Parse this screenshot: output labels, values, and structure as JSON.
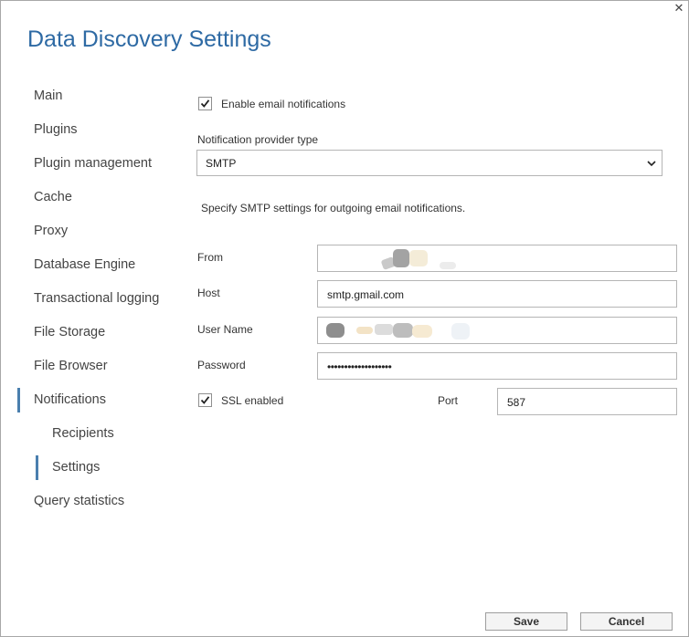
{
  "window": {
    "title": "Data Discovery Settings",
    "close_glyph": "✕"
  },
  "sidebar": {
    "items": [
      {
        "label": "Main"
      },
      {
        "label": "Plugins"
      },
      {
        "label": "Plugin management"
      },
      {
        "label": "Cache"
      },
      {
        "label": "Proxy"
      },
      {
        "label": "Database Engine"
      },
      {
        "label": "Transactional logging"
      },
      {
        "label": "File Storage"
      },
      {
        "label": "File Browser"
      },
      {
        "label": "Notifications"
      },
      {
        "label": "Recipients"
      },
      {
        "label": "Settings"
      },
      {
        "label": "Query statistics"
      }
    ]
  },
  "form": {
    "enable_notifications": {
      "label": "Enable email notifications",
      "checked": true
    },
    "provider_type": {
      "label": "Notification provider type",
      "value": "SMTP"
    },
    "smtp_hint": "Specify SMTP settings for outgoing email notifications.",
    "from": {
      "label": "From",
      "value": ""
    },
    "host": {
      "label": "Host",
      "value": "smtp.gmail.com"
    },
    "username": {
      "label": "User Name",
      "value": ""
    },
    "password": {
      "label": "Password",
      "value": "•••••••••••••••••••"
    },
    "ssl": {
      "label": "SSL enabled",
      "checked": true
    },
    "port": {
      "label": "Port",
      "value": "587"
    }
  },
  "buttons": {
    "save": "Save",
    "cancel": "Cancel"
  },
  "colors": {
    "title": "#2e6aa4",
    "active_indicator": "#4a7fae"
  }
}
